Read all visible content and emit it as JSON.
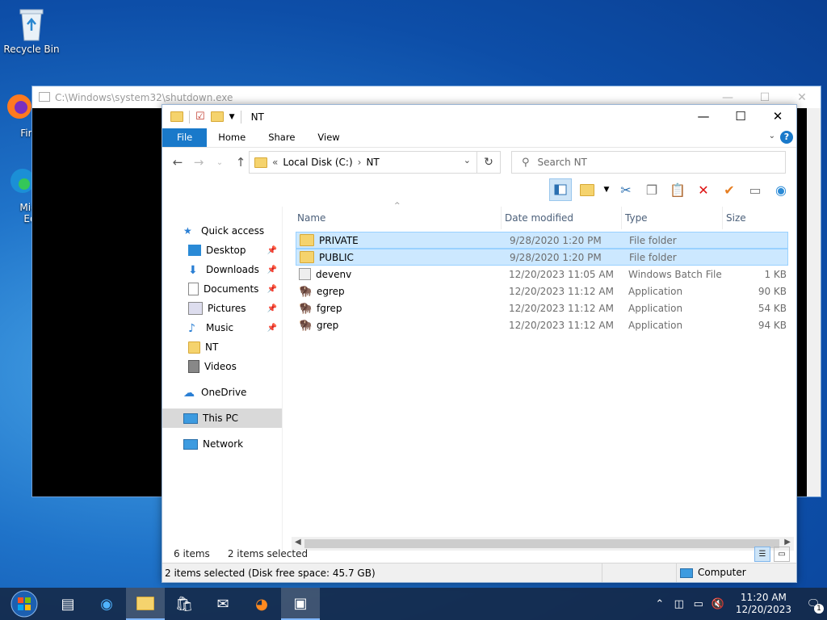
{
  "desktop": {
    "recycle_bin": "Recycle Bin",
    "firefox_label": "Fire",
    "edge_label_1": "Micr",
    "edge_label_2": "Ed"
  },
  "console": {
    "title": "C:\\Windows\\system32\\shutdown.exe"
  },
  "explorer": {
    "title": "NT",
    "ribbon": {
      "file": "File",
      "home": "Home",
      "share": "Share",
      "view": "View",
      "help": "?"
    },
    "address": {
      "prefix": "«",
      "crumb1": "Local Disk (C:)",
      "sep": "›",
      "crumb2": "NT"
    },
    "search_placeholder": "Search NT",
    "nav": [
      {
        "label": "Quick access"
      },
      {
        "label": "Desktop",
        "pinned": true
      },
      {
        "label": "Downloads",
        "pinned": true
      },
      {
        "label": "Documents",
        "pinned": true
      },
      {
        "label": "Pictures",
        "pinned": true
      },
      {
        "label": "Music",
        "pinned": true
      },
      {
        "label": "NT"
      },
      {
        "label": "Videos"
      },
      {
        "label": "OneDrive"
      },
      {
        "label": "This PC"
      },
      {
        "label": "Network"
      }
    ],
    "columns": {
      "name": "Name",
      "date": "Date modified",
      "type": "Type",
      "size": "Size"
    },
    "files": [
      {
        "name": "PRIVATE",
        "date": "9/28/2020 1:20 PM",
        "type": "File folder",
        "size": ""
      },
      {
        "name": "PUBLIC",
        "date": "9/28/2020 1:20 PM",
        "type": "File folder",
        "size": ""
      },
      {
        "name": "devenv",
        "date": "12/20/2023 11:05 AM",
        "type": "Windows Batch File",
        "size": "1 KB"
      },
      {
        "name": "egrep",
        "date": "12/20/2023 11:12 AM",
        "type": "Application",
        "size": "90 KB"
      },
      {
        "name": "fgrep",
        "date": "12/20/2023 11:12 AM",
        "type": "Application",
        "size": "54 KB"
      },
      {
        "name": "grep",
        "date": "12/20/2023 11:12 AM",
        "type": "Application",
        "size": "94 KB"
      }
    ],
    "status": {
      "items": "6 items",
      "selected": "2 items selected"
    },
    "bottom": {
      "info": "2 items selected (Disk free space: 45.7 GB)",
      "location": "Computer"
    }
  },
  "taskbar": {
    "time": "11:20 AM",
    "date": "12/20/2023",
    "notification_count": "1"
  },
  "colors": {
    "accent": "#1979ca",
    "selection": "#cce8ff",
    "folder": "#f5d36d"
  }
}
